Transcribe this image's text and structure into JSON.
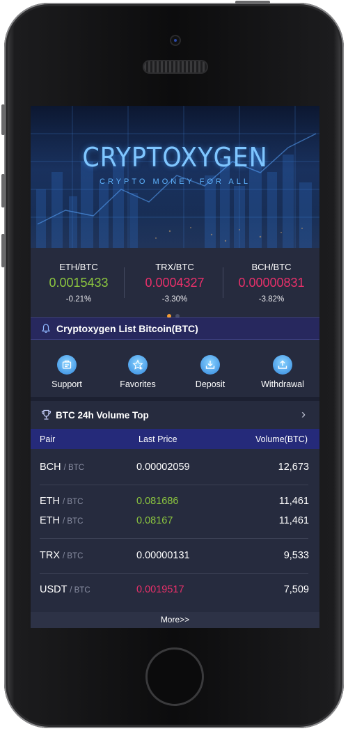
{
  "banner": {
    "brand": "CRYPTOXYGEN",
    "tagline": "CRYPTO MONEY FOR ALL"
  },
  "tickers": [
    {
      "pair": "ETH/BTC",
      "price": "0.0015433",
      "change": "-0.21%",
      "color": "#8cc63f"
    },
    {
      "pair": "TRX/BTC",
      "price": "0.0004327",
      "change": "-3.30%",
      "color": "#e8306a"
    },
    {
      "pair": "BCH/BTC",
      "price": "0.00000831",
      "change": "-3.82%",
      "color": "#e8306a"
    }
  ],
  "pager": {
    "active_color": "#f39c34",
    "inactive_color": "#4a5068",
    "pages": 2,
    "active": 1
  },
  "notice": {
    "icon": "bell-icon",
    "text": "Cryptoxygen List Bitcoin(BTC)"
  },
  "actions": [
    {
      "label": "Support",
      "icon": "support-icon"
    },
    {
      "label": "Favorites",
      "icon": "favorites-icon"
    },
    {
      "label": "Deposit",
      "icon": "deposit-icon"
    },
    {
      "label": "Withdrawal",
      "icon": "withdrawal-icon"
    }
  ],
  "volume": {
    "title": "BTC 24h Volume Top",
    "icon": "trophy-icon",
    "columns": {
      "pair": "Pair",
      "price": "Last Price",
      "volume": "Volume(BTC)"
    },
    "rows": [
      {
        "base": "BCH",
        "quote": "/ BTC",
        "price": "0.00002059",
        "volume": "12,673",
        "color": "#ffffff"
      },
      {
        "base": "ETH",
        "quote": "/ BTC",
        "price": "0.081686",
        "volume": "11,461",
        "color": "#8cc63f"
      },
      {
        "base": "ETH",
        "quote": "/ BTC",
        "price": "0.08167",
        "volume": "11,461",
        "color": "#8cc63f"
      },
      {
        "base": "TRX",
        "quote": "/ BTC",
        "price": "0.00000131",
        "volume": "9,533",
        "color": "#ffffff"
      },
      {
        "base": "USDT",
        "quote": "/ BTC",
        "price": "0.0019517",
        "volume": "7,509",
        "color": "#e8306a"
      }
    ],
    "more_label": "More>>"
  }
}
